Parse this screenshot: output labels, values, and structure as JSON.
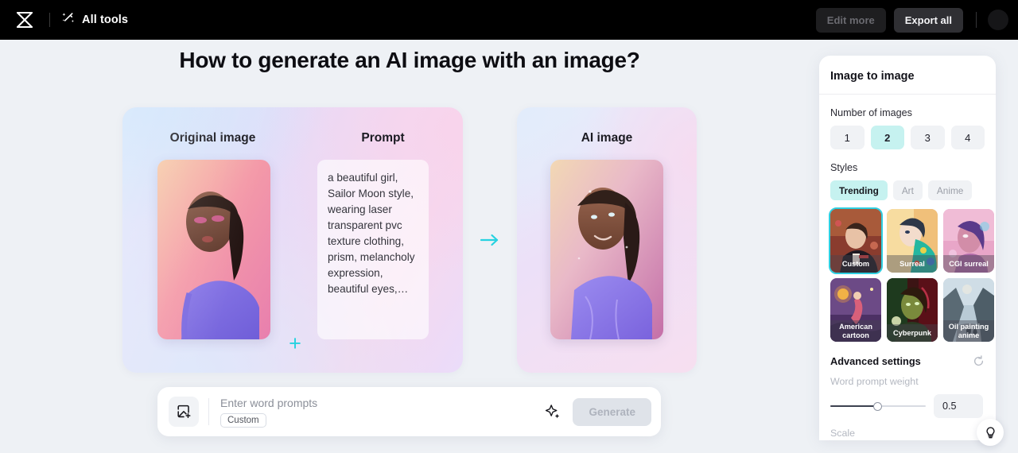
{
  "topbar": {
    "logo_icon": "capcut-logo-icon",
    "all_tools_label": "All tools",
    "all_tools_icon": "magic-wand-icon",
    "edit_more_label": "Edit more",
    "export_all_label": "Export all"
  },
  "page": {
    "title": "How to generate an AI image with an image?"
  },
  "demo": {
    "original_label": "Original image",
    "prompt_label": "Prompt",
    "prompt_text": "a beautiful girl, Sailor Moon style, wearing laser transparent pvc texture clothing, prism, melancholy expression, beautiful eyes,…",
    "plus_glyph": "+",
    "arrow_icon": "arrow-right-icon",
    "ai_label": "AI image",
    "accent_color": "#26d2e0"
  },
  "prompt_bar": {
    "add_image_icon": "add-image-icon",
    "placeholder": "Enter word prompts",
    "chip_label": "Custom",
    "magic_icon": "sparkle-icon",
    "generate_label": "Generate",
    "generate_disabled": true
  },
  "panel": {
    "title": "Image to image",
    "number_of_images_label": "Number of images",
    "number_options": [
      "1",
      "2",
      "3",
      "4"
    ],
    "number_selected": "2",
    "styles_label": "Styles",
    "style_tabs": [
      "Trending",
      "Art",
      "Anime"
    ],
    "style_tab_selected": "Trending",
    "style_thumbs": [
      {
        "label": "Custom",
        "selected": true
      },
      {
        "label": "Surreal",
        "selected": false
      },
      {
        "label": "CGI surreal",
        "selected": false
      },
      {
        "label": "American cartoon",
        "selected": false
      },
      {
        "label": "Cyberpunk",
        "selected": false
      },
      {
        "label": "Oil painting anime",
        "selected": false
      }
    ],
    "advanced_settings_label": "Advanced settings",
    "reset_icon": "reset-circle-icon",
    "word_prompt_weight_label": "Word prompt weight",
    "word_prompt_weight_value": "0.5",
    "word_prompt_weight_percent": 50,
    "scale_label": "Scale",
    "selected_color": "#c6f2f0",
    "highlight_border": "#2ecfe0"
  },
  "help": {
    "icon": "lightbulb-icon"
  }
}
